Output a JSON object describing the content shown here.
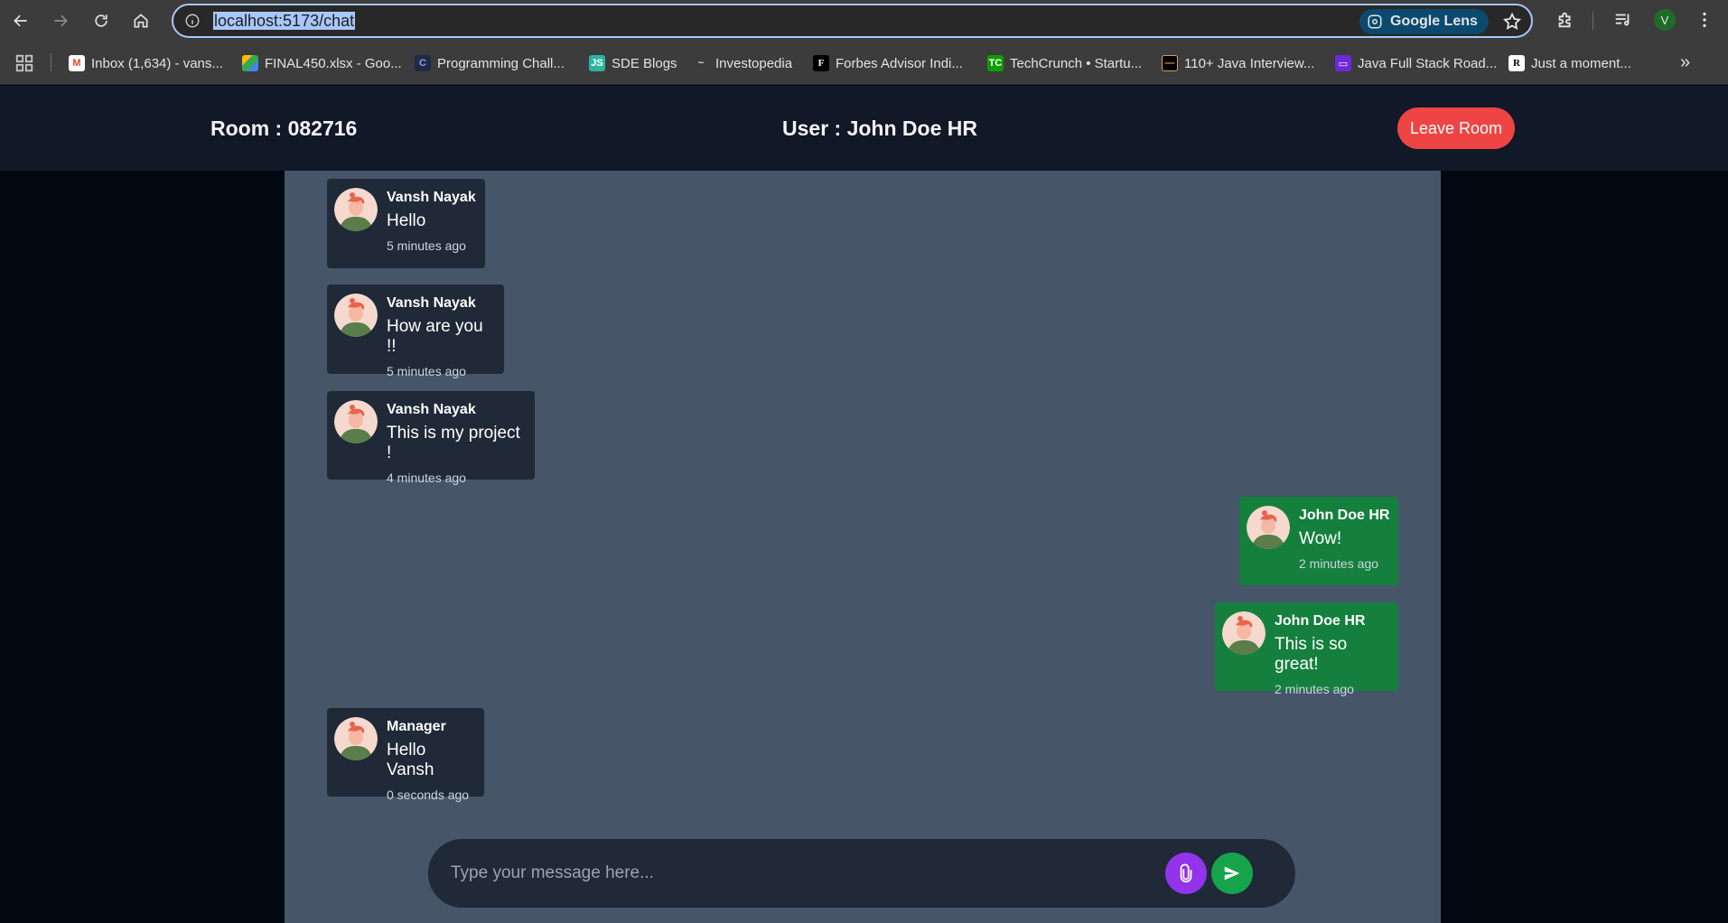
{
  "browser": {
    "url": "localhost:5173/chat",
    "lens_label": "Google Lens",
    "profile_initial": "V",
    "bookmarks": [
      {
        "label": "Inbox (1,634) - vans...",
        "icon": "gmail-icon"
      },
      {
        "label": "FINAL450.xlsx - Goo...",
        "icon": "drive-icon"
      },
      {
        "label": "Programming Chall...",
        "icon": "codechef-icon"
      },
      {
        "label": "SDE Blogs",
        "icon": "sde-icon"
      },
      {
        "label": "Investopedia",
        "icon": "investopedia-icon"
      },
      {
        "label": "Forbes Advisor Indi...",
        "icon": "forbes-icon"
      },
      {
        "label": "TechCrunch • Startu...",
        "icon": "techcrunch-icon"
      },
      {
        "label": "110+ Java Interview...",
        "icon": "java-icon"
      },
      {
        "label": "Java Full Stack Road...",
        "icon": "roadmap-icon"
      },
      {
        "label": "Just a moment...",
        "icon": "researchgate-icon"
      }
    ]
  },
  "header": {
    "room": "Room : 082716",
    "user": "User : John Doe HR",
    "leave_label": "Leave Room"
  },
  "messages": [
    {
      "sender": "Vansh Nayak",
      "text": "Hello",
      "time": "5 minutes ago",
      "mine": false
    },
    {
      "sender": "Vansh Nayak",
      "text": "How are you !!",
      "time": "5 minutes ago",
      "mine": false
    },
    {
      "sender": "Vansh Nayak",
      "text": "This is my project !",
      "time": "4 minutes ago",
      "mine": false
    },
    {
      "sender": "John Doe HR",
      "text": "Wow!",
      "time": "2 minutes ago",
      "mine": true
    },
    {
      "sender": "John Doe HR",
      "text": "This is so great!",
      "time": "2 minutes ago",
      "mine": true
    },
    {
      "sender": "Manager",
      "text": "Hello Vansh",
      "time": "0 seconds ago",
      "mine": false
    }
  ],
  "composer": {
    "placeholder": "Type your message here..."
  },
  "colors": {
    "header_bg": "#111827",
    "panel_bg": "#475569",
    "other_bubble": "#1f2937",
    "mine_bubble": "#15803d",
    "leave": "#ef4444",
    "attach": "#9333ea",
    "send": "#16a34a"
  }
}
